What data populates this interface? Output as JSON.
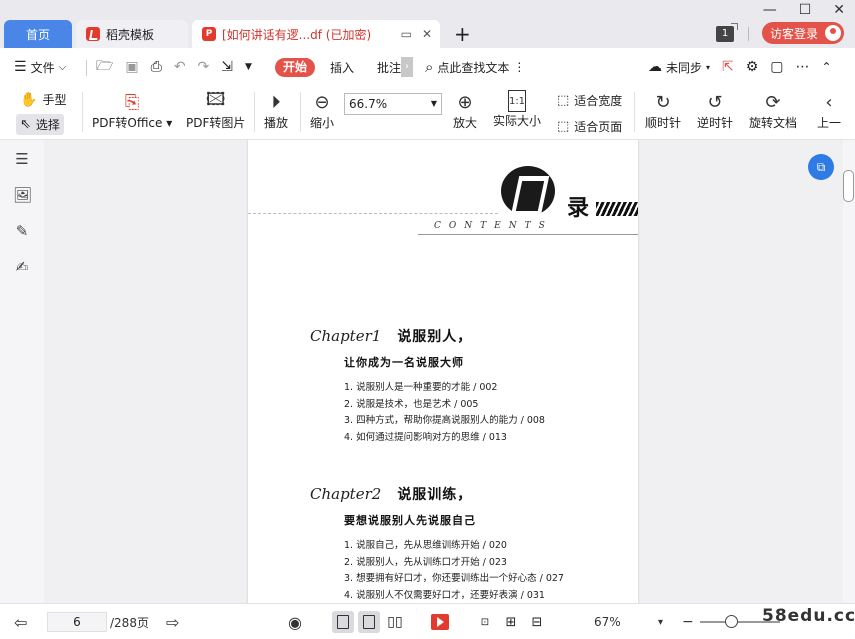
{
  "tabs": {
    "home": "首页",
    "template": "稻壳模板",
    "document": "[如何讲话有逻...df (已加密)"
  },
  "titlebar": {
    "badge_count": "1",
    "login_label": "访客登录"
  },
  "menubar": {
    "file": "文件",
    "start": "开始",
    "insert": "插入",
    "annotate": "批注",
    "search": "点此查找文本",
    "sync": "未同步"
  },
  "toolbar": {
    "hand": "手型",
    "select": "选择",
    "pdf_to_office": "PDF转Office",
    "pdf_to_image": "PDF转图片",
    "play": "播放",
    "zoom_out": "缩小",
    "zoom_value": "66.7%",
    "zoom_in": "放大",
    "actual_size": "实际大小",
    "actual_size_icon": "1:1",
    "fit_width": "适合宽度",
    "fit_page": "适合页面",
    "rotate_cw": "顺时针",
    "rotate_ccw": "逆时针",
    "rotate_doc": "旋转文档",
    "prev_cut": "上一"
  },
  "document": {
    "header_char": "录",
    "contents_word": "CONTENTS",
    "chapters": [
      {
        "label": "Chapter1",
        "title": "说服别人，",
        "subtitle": "让你成为一名说服大师",
        "items": [
          "1. 说服别人是一种重要的才能 / 002",
          "2. 说服是技术，也是艺术 / 005",
          "3. 四种方式，帮助你提高说服别人的能力 / 008",
          "4. 如何通过提问影响对方的思维 / 013"
        ]
      },
      {
        "label": "Chapter2",
        "title": "说服训练，",
        "subtitle": "要想说服别人先说服自己",
        "items": [
          "1. 说服自己，先从思维训练开始 / 020",
          "2. 说服别人，先从训练口才开始 / 023",
          "3. 想要拥有好口才，你还要训练出一个好心态 / 027",
          "4. 说服别人不仅需要好口才，还要好表演 / 031"
        ]
      }
    ]
  },
  "statusbar": {
    "current_page": "6",
    "total_pages": "/288页",
    "zoom": "67%",
    "watermark": "58edu.cc"
  },
  "colors": {
    "accent_blue": "#4a86e8",
    "accent_red": "#e4534a"
  }
}
